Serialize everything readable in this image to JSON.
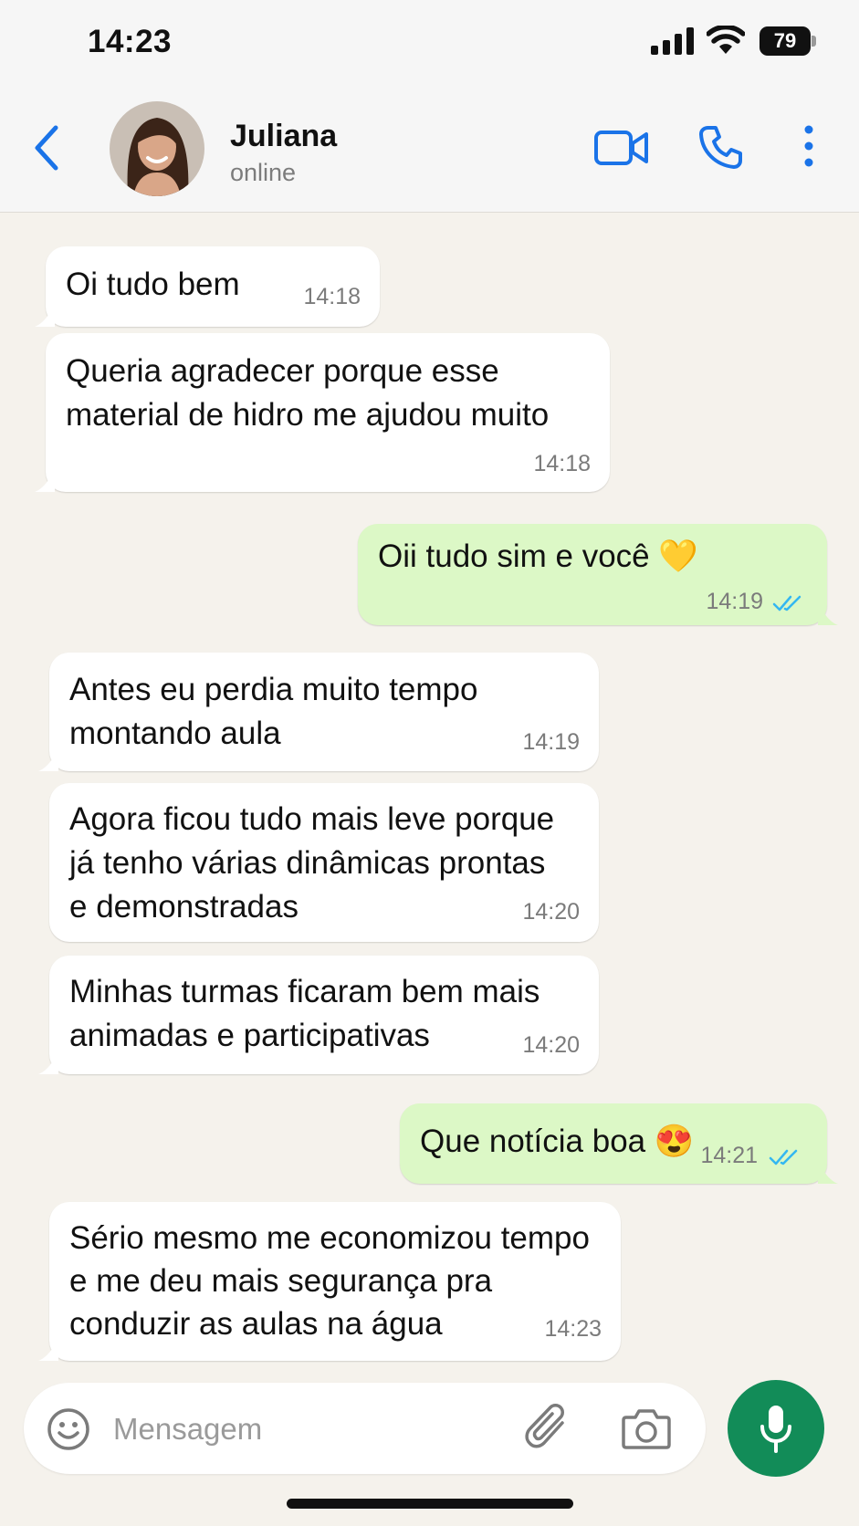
{
  "status_bar": {
    "time": "14:23",
    "battery_level": "79",
    "signal_icon": "cellular-signal-icon",
    "wifi_icon": "wifi-icon"
  },
  "header": {
    "back_icon": "chevron-left-icon",
    "contact_name": "Juliana",
    "contact_status": "online",
    "actions": [
      "video-call-icon",
      "phone-icon",
      "more-options-icon"
    ]
  },
  "messages": [
    {
      "direction": "in",
      "lines": [
        "Oi tudo bem"
      ],
      "time": "14:18"
    },
    {
      "direction": "in",
      "lines": [
        "Queria agradecer porque esse",
        "material de hidro me ajudou muito"
      ],
      "time": "14:18"
    },
    {
      "direction": "out",
      "lines": [
        "Oii tudo sim e você 💛"
      ],
      "time": "14:19",
      "read": true
    },
    {
      "direction": "in",
      "lines": [
        "Antes eu perdia muito tempo",
        "montando aula"
      ],
      "time": "14:19"
    },
    {
      "direction": "in",
      "lines": [
        "Agora ficou tudo mais leve porque",
        "já tenho várias dinâmicas prontas",
        "e demonstradas"
      ],
      "time": "14:20"
    },
    {
      "direction": "in",
      "lines": [
        "Minhas turmas ficaram bem mais",
        "animadas e participativas"
      ],
      "time": "14:20"
    },
    {
      "direction": "out",
      "lines": [
        "Que notícia boa 😍"
      ],
      "time": "14:21",
      "read": true
    },
    {
      "direction": "in",
      "lines": [
        "Sério mesmo me economizou tempo",
        "e me deu mais segurança pra",
        "conduzir as aulas na água"
      ],
      "time": "14:23"
    }
  ],
  "input": {
    "placeholder": "Mensagem",
    "value": ""
  },
  "colors": {
    "incoming_bubble": "#ffffff",
    "outgoing_bubble": "#dcf8c6",
    "accent_blue": "#1a73e8",
    "read_ticks": "#34b7f1",
    "mic_button": "#128c58",
    "chat_background": "#f5f2ec"
  }
}
